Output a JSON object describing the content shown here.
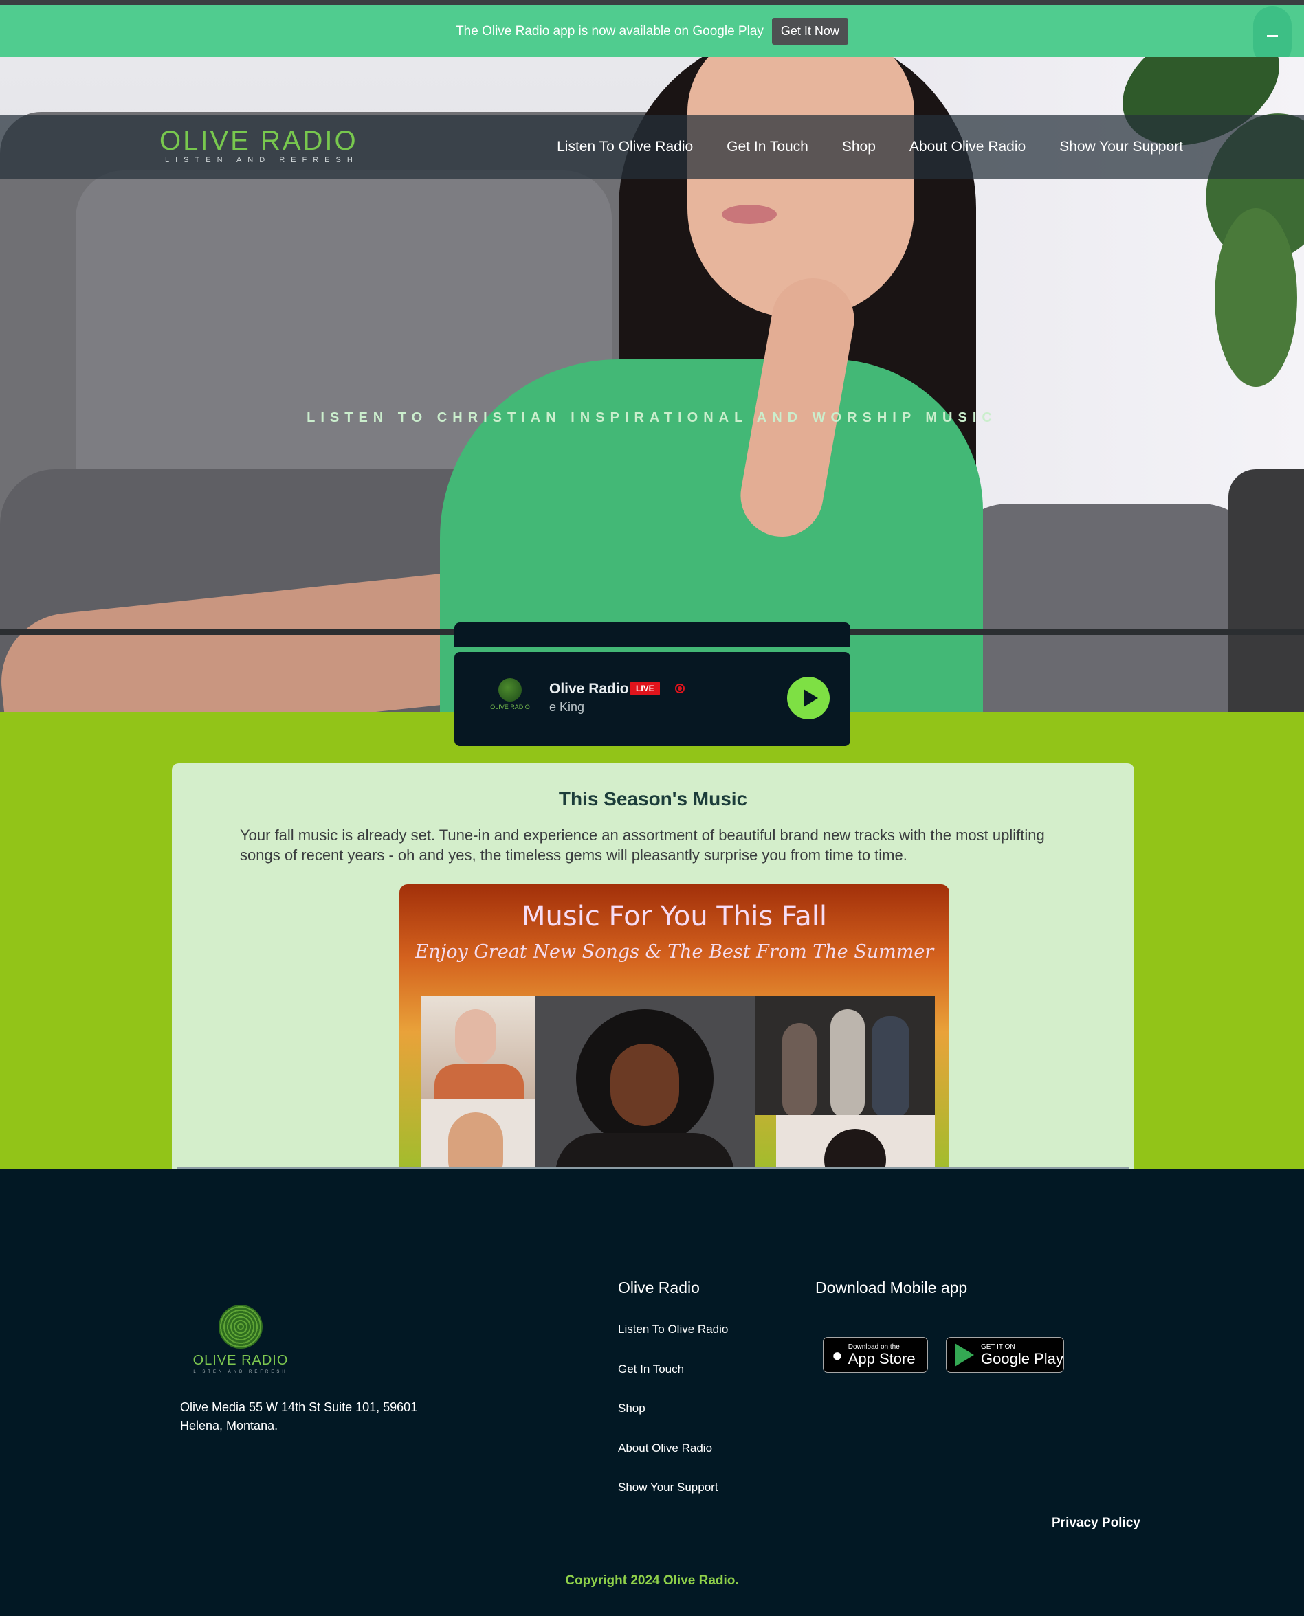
{
  "announcement": {
    "text": "The Olive Radio app is now available on Google Play",
    "button": "Get It Now",
    "close_icon": "minus-icon"
  },
  "header": {
    "logo_name": "OLIVE RADIO",
    "logo_tagline": "LISTEN AND REFRESH",
    "nav": [
      "Listen To Olive Radio",
      "Get In Touch",
      "Shop",
      "About Olive Radio",
      "Show Your Support"
    ]
  },
  "hero": {
    "tagline": "LISTEN TO CHRISTIAN INSPIRATIONAL AND WORSHIP MUSIC"
  },
  "player": {
    "logo_text": "OLIVE RADIO",
    "station": "Olive Radio",
    "live_badge": "LIVE",
    "now_playing": "e King",
    "play_icon": "play-icon"
  },
  "season": {
    "title": "This Season's Music",
    "text": "Your fall music is already set. Tune-in and experience an assortment of beautiful brand new tracks with the most uplifting songs of recent years - oh and yes, the timeless gems will pleasantly surprise you from time to time.",
    "poster_title": "Music For You This Fall",
    "poster_subtitle": "Enjoy Great New Songs & The Best From The Summer"
  },
  "footer": {
    "logo_name": "OLIVE RADIO",
    "logo_tagline": "LISTEN AND REFRESH",
    "address_line1": "Olive Media 55 W 14th St Suite 101, 59601",
    "address_line2": "Helena, Montana.",
    "links_title": "Olive Radio",
    "links": [
      "Listen To Olive Radio",
      "Get In Touch",
      "Shop",
      "About Olive Radio",
      "Show Your Support"
    ],
    "download_title": "Download Mobile app",
    "app_store_small": "Download on the",
    "app_store_big": "App Store",
    "google_play_small": "GET IT ON",
    "google_play_big": "Google Play",
    "privacy": "Privacy Policy",
    "copyright": "Copyright 2024 Olive Radio."
  },
  "colors": {
    "announcement_bg": "#50cc8f",
    "brand_green": "#78c84e",
    "section_green": "#92c418",
    "card_bg": "#d4eecb",
    "footer_bg": "#021824",
    "live_red": "#e0141c",
    "play_green": "#7ee044"
  }
}
